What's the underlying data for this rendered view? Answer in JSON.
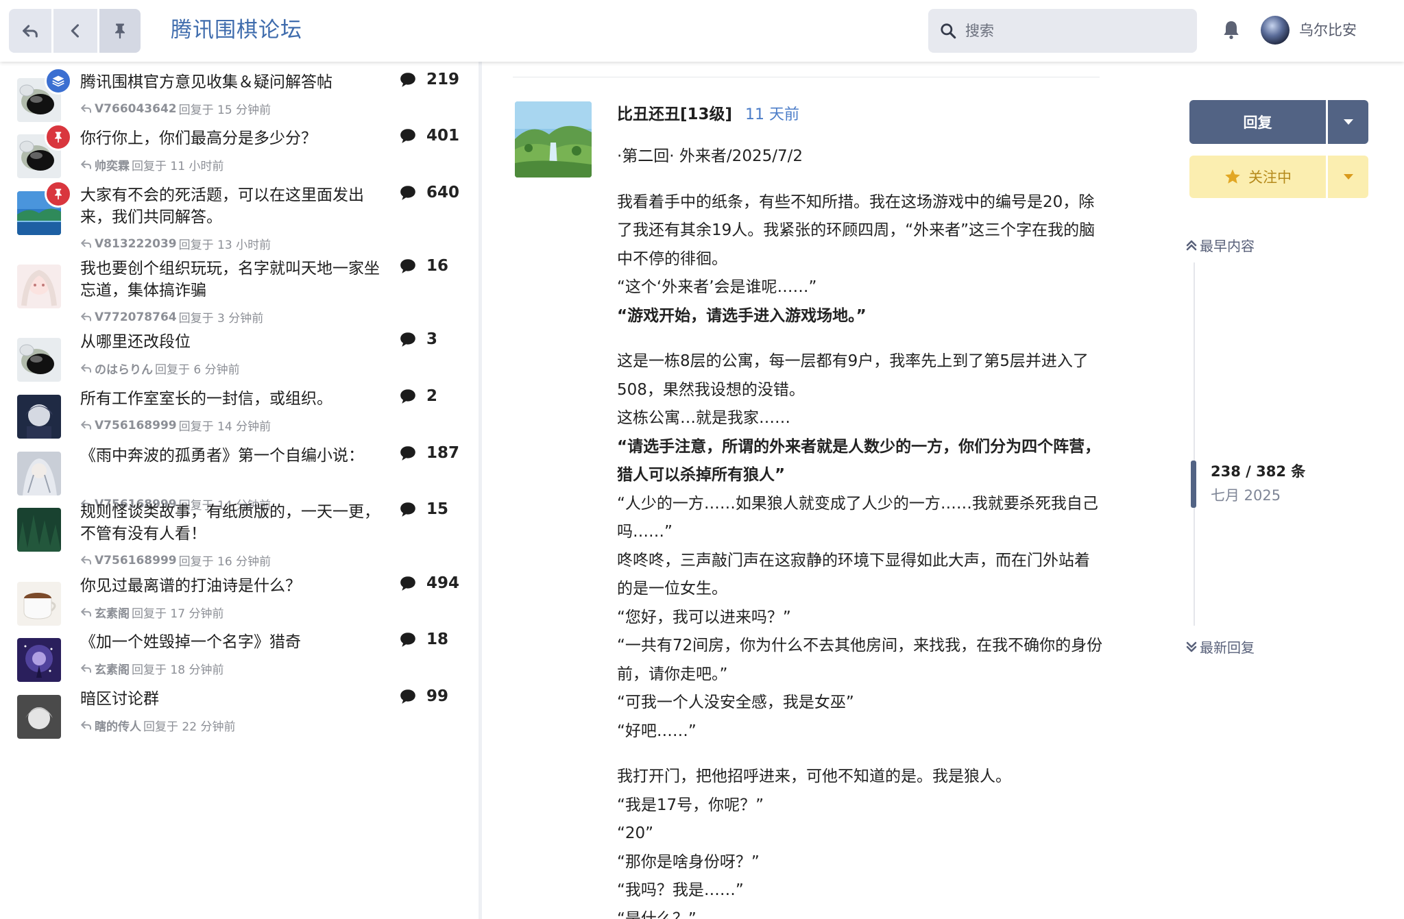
{
  "header": {
    "site_title": "腾讯围棋论坛",
    "search_placeholder": "搜索",
    "username": "乌尔比安"
  },
  "topics": [
    {
      "title": "腾讯围棋官方意见收集＆疑问解答帖",
      "last_user": "V766043642",
      "reply_text": "回复于 15 分钟前",
      "count": "219",
      "badge": "layers",
      "avatar": "go-stones"
    },
    {
      "title": "你行你上，你们最高分是多少分？",
      "last_user": "帅奕霖",
      "reply_text": "回复于 11 小时前",
      "count": "401",
      "badge": "pin",
      "avatar": "go-stones"
    },
    {
      "title": "大家有不会的死活题，可以在这里面发出来，我们共同解答。",
      "last_user": "V813222039",
      "reply_text": "回复于 13 小时前",
      "count": "640",
      "badge": "pin",
      "avatar": "landscape"
    },
    {
      "title": "我也要创个组织玩玩，名字就叫天地一家坐忘道，集体搞诈骗",
      "last_user": "V772078764",
      "reply_text": "回复于 3 分钟前",
      "count": "16",
      "badge": "",
      "avatar": "anime-pink"
    },
    {
      "title": "从哪里还改段位",
      "last_user": "のはらりん",
      "reply_text": "回复于 6 分钟前",
      "count": "3",
      "badge": "",
      "avatar": "go-stones"
    },
    {
      "title": "所有工作室室长的一封信，或组织。",
      "last_user": "V756168999",
      "reply_text": "回复于 14 分钟前",
      "count": "2",
      "badge": "",
      "avatar": "anime-dark"
    },
    {
      "title": "《雨中奔波的孤勇者》第一个自编小说：",
      "last_user": "V756168999",
      "reply_text": "回复于 14 分钟前",
      "count": "187",
      "badge": "",
      "avatar": "anime-silver"
    },
    {
      "title": "规则怪谈类故事，有纸质版的，一天一更，不管有没有人看！",
      "last_user": "V756168999",
      "reply_text": "回复于 16 分钟前",
      "count": "15",
      "badge": "",
      "avatar": "forest"
    },
    {
      "title": "你见过最离谱的打油诗是什么？",
      "last_user": "玄素阁",
      "reply_text": "回复于 17 分钟前",
      "count": "494",
      "badge": "",
      "avatar": "coffee"
    },
    {
      "title": "《加一个姓毁掉一个名字》猎奇",
      "last_user": "玄素阁",
      "reply_text": "回复于 18 分钟前",
      "count": "18",
      "badge": "",
      "avatar": "galaxy"
    },
    {
      "title": "暗区讨论群",
      "last_user": "瞎的传人",
      "reply_text": "回复于 22 分钟前",
      "count": "99",
      "badge": "",
      "avatar": "anime-gray"
    }
  ],
  "post": {
    "author": "比丑还丑[13级]",
    "time": "11 天前",
    "paragraphs": [
      {
        "text": "·第二回· 外来者/2025/7/2",
        "bold": false,
        "gap_after": true
      },
      {
        "text": "我看着手中的纸条，有些不知所措。我在这场游戏中的编号是20，除了我还有其余19人。我紧张的环顾四周，“外来者”这三个字在我的脑中不停的徘徊。",
        "bold": false,
        "gap_after": false
      },
      {
        "text": "“这个‘外来者’会是谁呢……”",
        "bold": false,
        "gap_after": false
      },
      {
        "text": "“游戏开始，请选手进入游戏场地。”",
        "bold": true,
        "gap_after": true
      },
      {
        "text": "这是一栋8层的公寓，每一层都有9户，我率先上到了第5层并进入了508，果然我设想的没错。",
        "bold": false,
        "gap_after": false
      },
      {
        "text": "这栋公寓…就是我家……",
        "bold": false,
        "gap_after": false
      },
      {
        "text": "“请选手注意，所谓的外来者就是人数少的一方，你们分为四个阵营，猎人可以杀掉所有狼人”",
        "bold": true,
        "gap_after": false
      },
      {
        "text": "“人少的一方……如果狼人就变成了人少的一方……我就要杀死我自己吗……”",
        "bold": false,
        "gap_after": false
      },
      {
        "text": "咚咚咚，三声敲门声在这寂静的环境下显得如此大声，而在门外站着的是一位女生。",
        "bold": false,
        "gap_after": false
      },
      {
        "text": "“您好，我可以进来吗？”",
        "bold": false,
        "gap_after": false
      },
      {
        "text": "“一共有72间房，你为什么不去其他房间，来找我，在我不确你的身份前，请你走吧。”",
        "bold": false,
        "gap_after": false
      },
      {
        "text": "“可我一个人没安全感，我是女巫”",
        "bold": false,
        "gap_after": false
      },
      {
        "text": "“好吧……”",
        "bold": false,
        "gap_after": true
      },
      {
        "text": "我打开门，把他招呼进来，可他不知道的是。我是狼人。",
        "bold": false,
        "gap_after": false
      },
      {
        "text": "“我是17号，你呢？”",
        "bold": false,
        "gap_after": false
      },
      {
        "text": "“20”",
        "bold": false,
        "gap_after": false
      },
      {
        "text": "“那你是啥身份呀？”",
        "bold": false,
        "gap_after": false
      },
      {
        "text": "“我吗？我是……”",
        "bold": false,
        "gap_after": false
      },
      {
        "text": "“是什么？”",
        "bold": false,
        "gap_after": false
      }
    ]
  },
  "timeline": {
    "reply_label": "回复",
    "watch_label": "关注中",
    "top_link": "最早内容",
    "position": "238 / 382 条",
    "date": "七月 2025",
    "bottom_link": "最新回复"
  },
  "colors": {
    "accent_blue": "#3f6cad",
    "button_primary": "#526384",
    "watch_bg": "#fbeeb0",
    "badge_blue": "#3b6fd1",
    "badge_red": "#d9363e"
  }
}
